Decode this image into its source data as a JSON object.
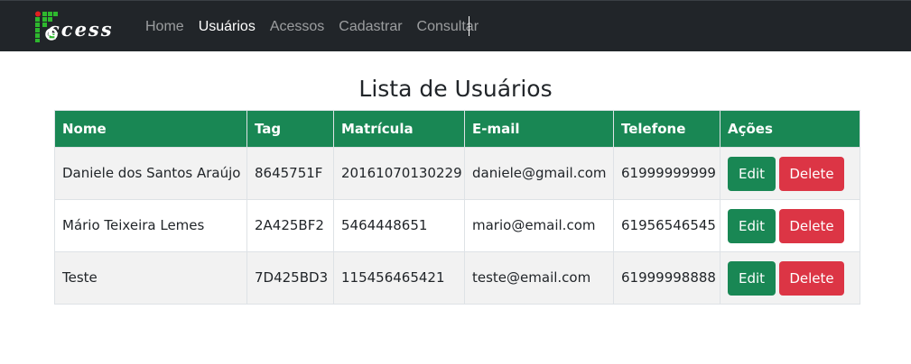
{
  "navbar": {
    "brand": "ccess",
    "links": [
      "Home",
      "Usuários",
      "Acessos",
      "Cadastrar",
      "Consultar"
    ],
    "active": "Usuários",
    "bg_color": "#212529"
  },
  "page": {
    "title": "Lista de Usuários"
  },
  "table": {
    "header_color": "#198754",
    "columns": [
      "Nome",
      "Tag",
      "Matrícula",
      "E-mail",
      "Telefone",
      "Ações"
    ],
    "rows": [
      [
        "Daniele dos Santos Araújo",
        "8645751F",
        "20161070130229",
        "daniele@gmail.com",
        "61999999999"
      ],
      [
        "Mário Teixeira Lemes",
        "2A425BF2",
        "5464448651",
        "mario@email.com",
        "61956546545"
      ],
      [
        "Teste",
        "7D425BD3",
        "115456465421",
        "teste@email.com",
        "61999998888"
      ]
    ],
    "actions": {
      "edit": "Edit",
      "delete": "Delete"
    }
  },
  "colors": {
    "edit": "#198754",
    "delete": "#dc3545"
  }
}
